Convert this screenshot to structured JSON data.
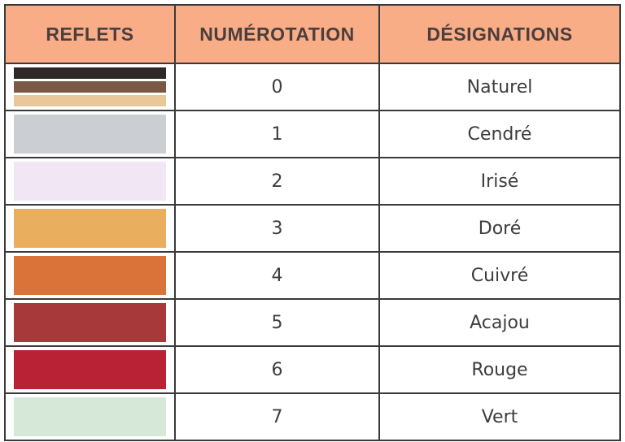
{
  "headers": [
    "REFLETS",
    "NUMÉROTATION",
    "DÉSIGNATIONS"
  ],
  "rows": [
    {
      "number": "0",
      "name": "Naturel",
      "colors": [
        "#2e2926",
        "#7a5843",
        "#e8c79a"
      ]
    },
    {
      "number": "1",
      "name": "Cendré",
      "colors": [
        "#cbced3"
      ]
    },
    {
      "number": "2",
      "name": "Irisé",
      "colors": [
        "#f1e6f3"
      ]
    },
    {
      "number": "3",
      "name": "Doré",
      "colors": [
        "#e9af5e"
      ]
    },
    {
      "number": "4",
      "name": "Cuivré",
      "colors": [
        "#d9733a"
      ]
    },
    {
      "number": "5",
      "name": "Acajou",
      "colors": [
        "#a8393b"
      ]
    },
    {
      "number": "6",
      "name": "Rouge",
      "colors": [
        "#b82234"
      ]
    },
    {
      "number": "7",
      "name": "Vert",
      "colors": [
        "#d6e8d8"
      ]
    }
  ]
}
